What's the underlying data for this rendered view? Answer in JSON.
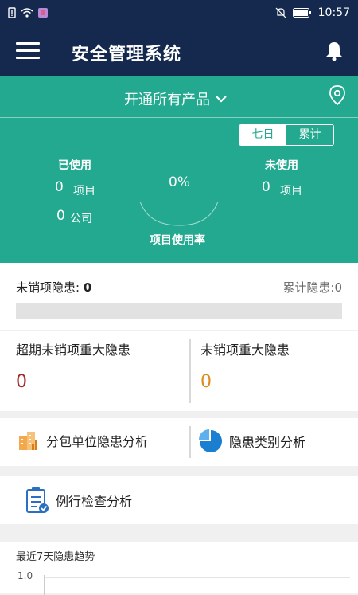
{
  "status": {
    "time": "10:57"
  },
  "app": {
    "title": "安全管理系统"
  },
  "product": {
    "selected": "开通所有产品"
  },
  "range_tabs": [
    {
      "label": "七日",
      "active": true
    },
    {
      "label": "累计",
      "active": false
    }
  ],
  "usage": {
    "used_label": "已使用",
    "used_projects": "0",
    "project_unit": "项目",
    "used_companies": "0",
    "company_unit": "公司",
    "rate": "0%",
    "rate_label": "项目使用率",
    "unused_label": "未使用",
    "unused_projects": "0"
  },
  "hazards": {
    "open_label": "未销项隐患:",
    "open_value": "0",
    "total": "累计隐患:0",
    "progress": 0
  },
  "major": {
    "overdue_label": "超期未销项重大隐患",
    "overdue_value": "0",
    "open_label": "未销项重大隐患",
    "open_value": "0"
  },
  "analysis": {
    "subcontract": "分包单位隐患分析",
    "category": "隐患类别分析",
    "routine": "例行检查分析"
  },
  "trend": {
    "title": "最近7天隐患趋势",
    "y_tick": "1.0"
  },
  "colors": {
    "navy": "#14294d",
    "teal": "#22a98f",
    "red": "#a32b2b",
    "orange": "#e08a1e",
    "blue": "#1a7fd1"
  }
}
